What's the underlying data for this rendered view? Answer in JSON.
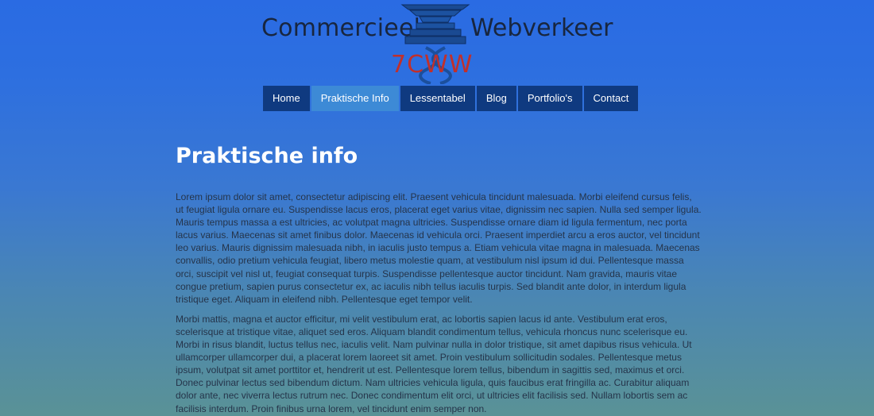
{
  "header": {
    "brand_left": "Commercieel",
    "brand_right": "Webverkeer",
    "logo_code": "7CWW",
    "logo_icon": "stacked-books-dna-icon"
  },
  "nav": {
    "items": [
      {
        "label": "Home",
        "active": false
      },
      {
        "label": "Praktische Info",
        "active": true
      },
      {
        "label": "Lessentabel",
        "active": false
      },
      {
        "label": "Blog",
        "active": false
      },
      {
        "label": "Portfolio's",
        "active": false
      },
      {
        "label": "Contact",
        "active": false
      }
    ]
  },
  "main": {
    "title": "Praktische info",
    "paragraphs": [
      "Lorem ipsum dolor sit amet, consectetur adipiscing elit. Praesent vehicula tincidunt malesuada. Morbi eleifend cursus felis, ut feugiat ligula ornare eu. Suspendisse lacus eros, placerat eget varius vitae, dignissim nec sapien. Nulla sed semper ligula. Mauris tempus massa a est ultricies, ac volutpat magna ultricies. Suspendisse ornare diam id ligula fermentum, nec porta lacus varius. Maecenas sit amet finibus dolor. Maecenas id vehicula orci. Praesent imperdiet arcu a eros auctor, vel tincidunt leo varius. Mauris dignissim malesuada nibh, in iaculis justo tempus a. Etiam vehicula vitae magna in malesuada. Maecenas convallis, odio pretium vehicula feugiat, libero metus molestie quam, at vestibulum nisl ipsum id dui. Pellentesque massa orci, suscipit vel nisl ut, feugiat consequat turpis. Suspendisse pellentesque auctor tincidunt. Nam gravida, mauris vitae congue pretium, sapien purus consectetur ex, ac iaculis nibh tellus iaculis turpis. Sed blandit ante dolor, in interdum ligula tristique eget. Aliquam in eleifend nibh. Pellentesque eget tempor velit.",
      "Morbi mattis, magna et auctor efficitur, mi velit vestibulum erat, ac lobortis sapien lacus id ante. Vestibulum erat eros, scelerisque at tristique vitae, aliquet sed eros. Aliquam blandit condimentum tellus, vehicula rhoncus nunc scelerisque eu. Morbi in risus blandit, luctus tellus nec, iaculis velit. Nam pulvinar nulla in dolor tristique, sit amet dapibus risus vehicula. Ut ullamcorper ullamcorper dui, a placerat lorem laoreet sit amet. Proin vestibulum sollicitudin sodales. Pellentesque metus ipsum, volutpat sit amet porttitor et, hendrerit ut est. Pellentesque lorem tellus, bibendum in sagittis sed, maximus et orci. Donec pulvinar lectus sed bibendum dictum. Nam ultricies vehicula ligula, quis faucibus erat fringilla ac. Curabitur aliquam dolor ante, nec viverra lectus rutrum nec. Donec condimentum elit orci, ut ultricies elit facilisis sed. Nullam lobortis sem ac facilisis interdum. Proin finibus urna lorem, vel tincidunt enim semper non."
    ]
  },
  "colors": {
    "nav_bg": "#0f3a80",
    "nav_active_bg": "#3d8ad6",
    "brand_text": "#18263f",
    "logo_code": "#c0302b",
    "logo_blue": "#1b4f9c"
  }
}
